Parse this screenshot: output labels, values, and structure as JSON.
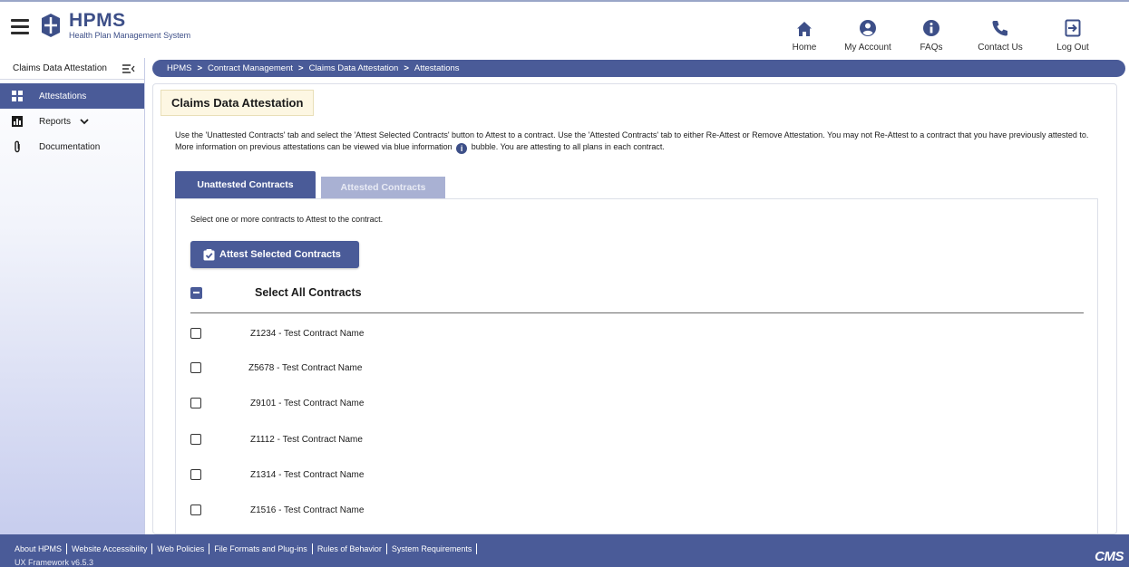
{
  "app": {
    "title": "HPMS",
    "subtitle": "Health Plan Management System"
  },
  "topnav": [
    {
      "label": "Home",
      "icon": "home-icon"
    },
    {
      "label": "My Account",
      "icon": "account-icon"
    },
    {
      "label": "FAQs",
      "icon": "info-icon"
    },
    {
      "label": "Contact Us",
      "icon": "phone-icon"
    },
    {
      "label": "Log Out",
      "icon": "logout-icon"
    }
  ],
  "sidebar": {
    "heading": "Claims Data Attestation",
    "items": [
      {
        "label": "Attestations",
        "icon": "grid-icon",
        "active": true
      },
      {
        "label": "Reports",
        "icon": "bar-chart-icon"
      },
      {
        "label": "Documentation",
        "icon": "paperclip-icon"
      }
    ]
  },
  "breadcrumb": [
    "HPMS",
    "Contract Management",
    "Claims Data Attestation",
    "Attestations"
  ],
  "main": {
    "page_title": "Claims Data Attestation",
    "instructions_part1": "Use the 'Unattested Contracts' tab and select the 'Attest Selected Contracts' button to Attest to a contract. Use the 'Attested Contracts' tab to either Re-Attest or Remove Attestation. You may not Re-Attest to a contract that you have previously attested to. More information on previous attestations can be viewed via blue information",
    "instructions_part2": "bubble. You are attesting to all plans in each contract.",
    "tabs": [
      {
        "label": "Unattested Contracts",
        "active": true
      },
      {
        "label": "Attested Contracts",
        "active": false
      }
    ],
    "select_hint": "Select one or more contracts to Attest to the contract.",
    "attest_button": "Attest Selected Contracts",
    "select_all": "Select All Contracts",
    "contracts": [
      "Z1234 - Test Contract Name",
      "Z5678 - Test Contract Name",
      "Z9101 - Test Contract Name",
      "Z1112 - Test Contract Name",
      "Z1314 - Test Contract Name",
      "Z1516 - Test Contract Name"
    ]
  },
  "footer": {
    "links": [
      "About HPMS",
      "Website Accessibility",
      "Web Policies",
      "File Formats and Plug-ins",
      "Rules of Behavior",
      "System Requirements"
    ],
    "version": "UX Framework v6.5.3",
    "logo": "CMS"
  },
  "colors": {
    "brand": "#4a5b98",
    "brand_dark": "#3d4f88",
    "title_bg": "#fdf7e3"
  }
}
